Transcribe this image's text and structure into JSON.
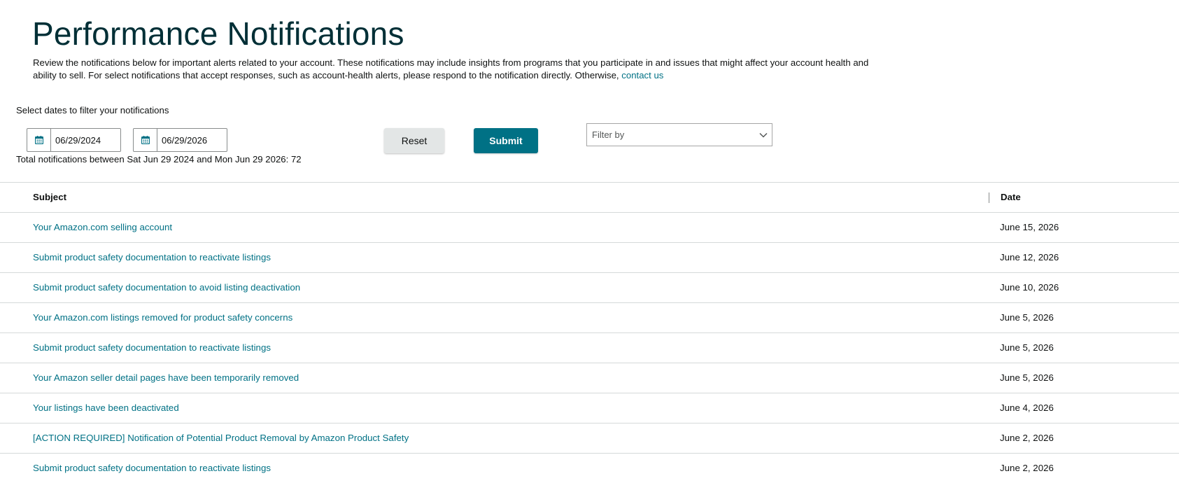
{
  "page": {
    "title": "Performance Notifications",
    "intro_text": "Review the notifications below for important alerts related to your account. These notifications may include insights from programs that you participate in and issues that might affect your account health and ability to sell. For select notifications that accept responses, such as account-health alerts, please respond to the notification directly. Otherwise, ",
    "contact_link": "contact us"
  },
  "filters": {
    "label": "Select dates to filter your notifications",
    "start_date": "06/29/2024",
    "end_date": "06/29/2026",
    "reset_label": "Reset",
    "submit_label": "Submit",
    "filter_placeholder": "Filter by",
    "total_text": "Total notifications between Sat Jun 29 2024 and Mon Jun 29 2026: 72"
  },
  "table": {
    "headers": {
      "subject": "Subject",
      "date": "Date"
    },
    "rows": [
      {
        "subject": "Your Amazon.com selling account",
        "date": "June 15, 2026"
      },
      {
        "subject": "Submit product safety documentation to reactivate listings",
        "date": "June 12, 2026"
      },
      {
        "subject": "Submit product safety documentation to avoid listing deactivation",
        "date": "June 10, 2026"
      },
      {
        "subject": "Your Amazon.com listings removed for product safety concerns",
        "date": "June 5, 2026"
      },
      {
        "subject": "Submit product safety documentation to reactivate listings",
        "date": "June 5, 2026"
      },
      {
        "subject": "Your Amazon seller detail pages have been temporarily removed",
        "date": "June 5, 2026"
      },
      {
        "subject": "Your listings have been deactivated",
        "date": "June 4, 2026"
      },
      {
        "subject": "[ACTION REQUIRED] Notification of Potential Product Removal by Amazon Product Safety",
        "date": "June 2, 2026"
      },
      {
        "subject": "Submit product safety documentation to reactivate listings",
        "date": "June 2, 2026"
      }
    ]
  },
  "colors": {
    "link": "#007185",
    "title": "#002f36",
    "submit_bg": "#007185",
    "reset_bg": "#e3e6e6"
  },
  "icons": {
    "date_picker": "calendar-icon",
    "select": "chevron-down-icon"
  }
}
